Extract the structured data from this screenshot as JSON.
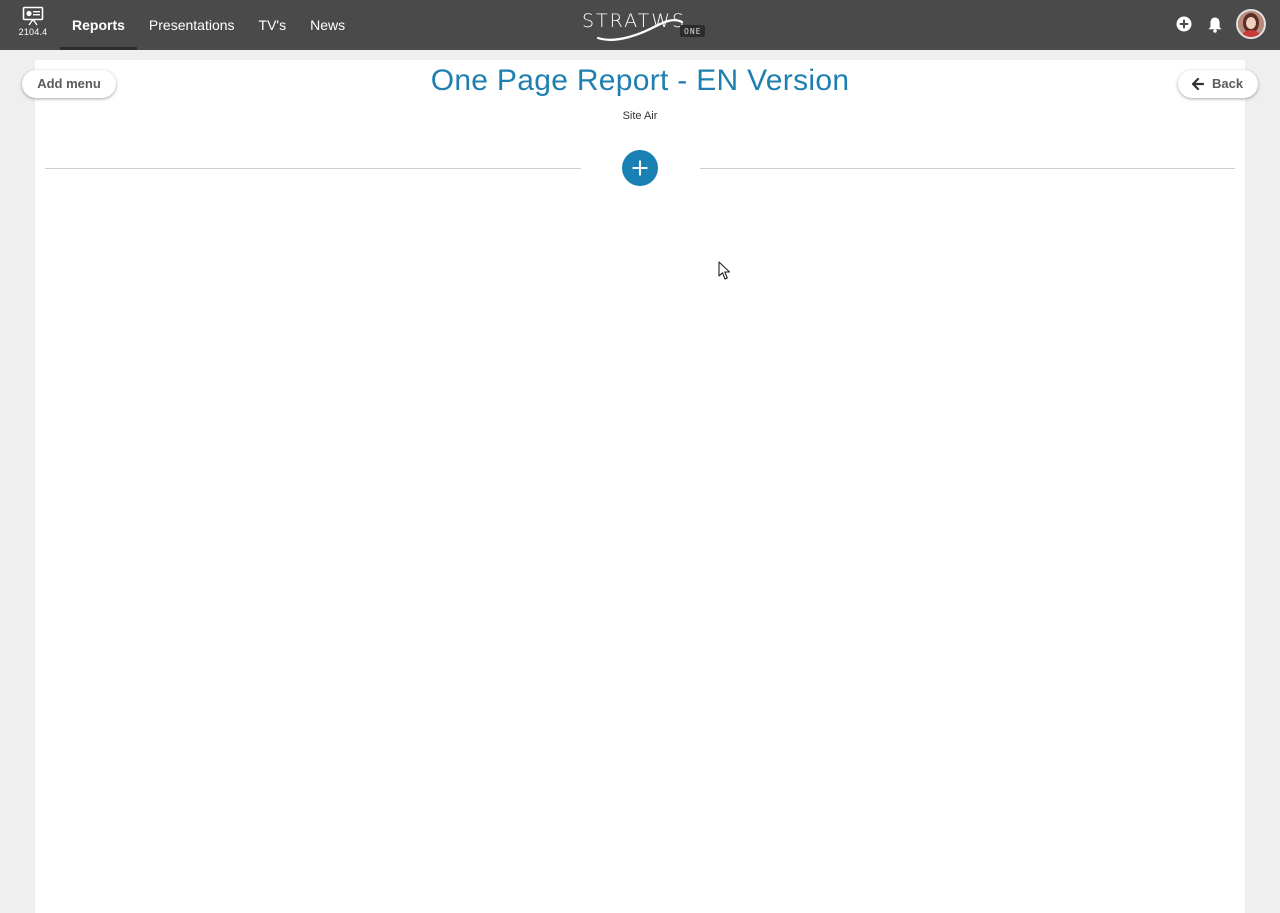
{
  "app": {
    "version": "2104.4",
    "logo_text": "STRATWS",
    "logo_badge": "ONE"
  },
  "nav": {
    "items": [
      {
        "label": "Reports",
        "active": true
      },
      {
        "label": "Presentations",
        "active": false
      },
      {
        "label": "TV's",
        "active": false
      },
      {
        "label": "News",
        "active": false
      }
    ]
  },
  "header_actions": {
    "add_icon": "plus-circle-icon",
    "notifications_icon": "bell-icon",
    "avatar_icon": "user-avatar"
  },
  "page": {
    "title": "One Page Report - EN Version",
    "subtitle": "Site Air",
    "add_menu_label": "Add menu",
    "back_label": "Back"
  },
  "colors": {
    "topbar": "#4a4a4a",
    "accent": "#1a7fb3",
    "title": "#1f80b0",
    "background": "#efefef"
  }
}
